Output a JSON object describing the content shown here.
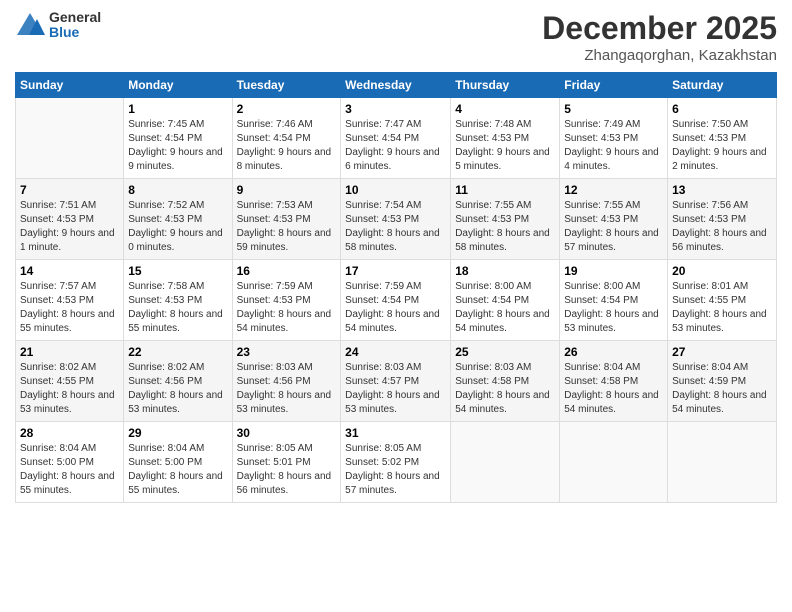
{
  "header": {
    "logo": {
      "general": "General",
      "blue": "Blue"
    },
    "title": "December 2025",
    "location": "Zhangaqorghan, Kazakhstan"
  },
  "days_header": [
    "Sunday",
    "Monday",
    "Tuesday",
    "Wednesday",
    "Thursday",
    "Friday",
    "Saturday"
  ],
  "weeks": [
    [
      {
        "day": "",
        "sunrise": "",
        "sunset": "",
        "daylight": ""
      },
      {
        "day": "1",
        "sunrise": "Sunrise: 7:45 AM",
        "sunset": "Sunset: 4:54 PM",
        "daylight": "Daylight: 9 hours and 9 minutes."
      },
      {
        "day": "2",
        "sunrise": "Sunrise: 7:46 AM",
        "sunset": "Sunset: 4:54 PM",
        "daylight": "Daylight: 9 hours and 8 minutes."
      },
      {
        "day": "3",
        "sunrise": "Sunrise: 7:47 AM",
        "sunset": "Sunset: 4:54 PM",
        "daylight": "Daylight: 9 hours and 6 minutes."
      },
      {
        "day": "4",
        "sunrise": "Sunrise: 7:48 AM",
        "sunset": "Sunset: 4:53 PM",
        "daylight": "Daylight: 9 hours and 5 minutes."
      },
      {
        "day": "5",
        "sunrise": "Sunrise: 7:49 AM",
        "sunset": "Sunset: 4:53 PM",
        "daylight": "Daylight: 9 hours and 4 minutes."
      },
      {
        "day": "6",
        "sunrise": "Sunrise: 7:50 AM",
        "sunset": "Sunset: 4:53 PM",
        "daylight": "Daylight: 9 hours and 2 minutes."
      }
    ],
    [
      {
        "day": "7",
        "sunrise": "Sunrise: 7:51 AM",
        "sunset": "Sunset: 4:53 PM",
        "daylight": "Daylight: 9 hours and 1 minute."
      },
      {
        "day": "8",
        "sunrise": "Sunrise: 7:52 AM",
        "sunset": "Sunset: 4:53 PM",
        "daylight": "Daylight: 9 hours and 0 minutes."
      },
      {
        "day": "9",
        "sunrise": "Sunrise: 7:53 AM",
        "sunset": "Sunset: 4:53 PM",
        "daylight": "Daylight: 8 hours and 59 minutes."
      },
      {
        "day": "10",
        "sunrise": "Sunrise: 7:54 AM",
        "sunset": "Sunset: 4:53 PM",
        "daylight": "Daylight: 8 hours and 58 minutes."
      },
      {
        "day": "11",
        "sunrise": "Sunrise: 7:55 AM",
        "sunset": "Sunset: 4:53 PM",
        "daylight": "Daylight: 8 hours and 58 minutes."
      },
      {
        "day": "12",
        "sunrise": "Sunrise: 7:55 AM",
        "sunset": "Sunset: 4:53 PM",
        "daylight": "Daylight: 8 hours and 57 minutes."
      },
      {
        "day": "13",
        "sunrise": "Sunrise: 7:56 AM",
        "sunset": "Sunset: 4:53 PM",
        "daylight": "Daylight: 8 hours and 56 minutes."
      }
    ],
    [
      {
        "day": "14",
        "sunrise": "Sunrise: 7:57 AM",
        "sunset": "Sunset: 4:53 PM",
        "daylight": "Daylight: 8 hours and 55 minutes."
      },
      {
        "day": "15",
        "sunrise": "Sunrise: 7:58 AM",
        "sunset": "Sunset: 4:53 PM",
        "daylight": "Daylight: 8 hours and 55 minutes."
      },
      {
        "day": "16",
        "sunrise": "Sunrise: 7:59 AM",
        "sunset": "Sunset: 4:53 PM",
        "daylight": "Daylight: 8 hours and 54 minutes."
      },
      {
        "day": "17",
        "sunrise": "Sunrise: 7:59 AM",
        "sunset": "Sunset: 4:54 PM",
        "daylight": "Daylight: 8 hours and 54 minutes."
      },
      {
        "day": "18",
        "sunrise": "Sunrise: 8:00 AM",
        "sunset": "Sunset: 4:54 PM",
        "daylight": "Daylight: 8 hours and 54 minutes."
      },
      {
        "day": "19",
        "sunrise": "Sunrise: 8:00 AM",
        "sunset": "Sunset: 4:54 PM",
        "daylight": "Daylight: 8 hours and 53 minutes."
      },
      {
        "day": "20",
        "sunrise": "Sunrise: 8:01 AM",
        "sunset": "Sunset: 4:55 PM",
        "daylight": "Daylight: 8 hours and 53 minutes."
      }
    ],
    [
      {
        "day": "21",
        "sunrise": "Sunrise: 8:02 AM",
        "sunset": "Sunset: 4:55 PM",
        "daylight": "Daylight: 8 hours and 53 minutes."
      },
      {
        "day": "22",
        "sunrise": "Sunrise: 8:02 AM",
        "sunset": "Sunset: 4:56 PM",
        "daylight": "Daylight: 8 hours and 53 minutes."
      },
      {
        "day": "23",
        "sunrise": "Sunrise: 8:03 AM",
        "sunset": "Sunset: 4:56 PM",
        "daylight": "Daylight: 8 hours and 53 minutes."
      },
      {
        "day": "24",
        "sunrise": "Sunrise: 8:03 AM",
        "sunset": "Sunset: 4:57 PM",
        "daylight": "Daylight: 8 hours and 53 minutes."
      },
      {
        "day": "25",
        "sunrise": "Sunrise: 8:03 AM",
        "sunset": "Sunset: 4:58 PM",
        "daylight": "Daylight: 8 hours and 54 minutes."
      },
      {
        "day": "26",
        "sunrise": "Sunrise: 8:04 AM",
        "sunset": "Sunset: 4:58 PM",
        "daylight": "Daylight: 8 hours and 54 minutes."
      },
      {
        "day": "27",
        "sunrise": "Sunrise: 8:04 AM",
        "sunset": "Sunset: 4:59 PM",
        "daylight": "Daylight: 8 hours and 54 minutes."
      }
    ],
    [
      {
        "day": "28",
        "sunrise": "Sunrise: 8:04 AM",
        "sunset": "Sunset: 5:00 PM",
        "daylight": "Daylight: 8 hours and 55 minutes."
      },
      {
        "day": "29",
        "sunrise": "Sunrise: 8:04 AM",
        "sunset": "Sunset: 5:00 PM",
        "daylight": "Daylight: 8 hours and 55 minutes."
      },
      {
        "day": "30",
        "sunrise": "Sunrise: 8:05 AM",
        "sunset": "Sunset: 5:01 PM",
        "daylight": "Daylight: 8 hours and 56 minutes."
      },
      {
        "day": "31",
        "sunrise": "Sunrise: 8:05 AM",
        "sunset": "Sunset: 5:02 PM",
        "daylight": "Daylight: 8 hours and 57 minutes."
      },
      {
        "day": "",
        "sunrise": "",
        "sunset": "",
        "daylight": ""
      },
      {
        "day": "",
        "sunrise": "",
        "sunset": "",
        "daylight": ""
      },
      {
        "day": "",
        "sunrise": "",
        "sunset": "",
        "daylight": ""
      }
    ]
  ]
}
